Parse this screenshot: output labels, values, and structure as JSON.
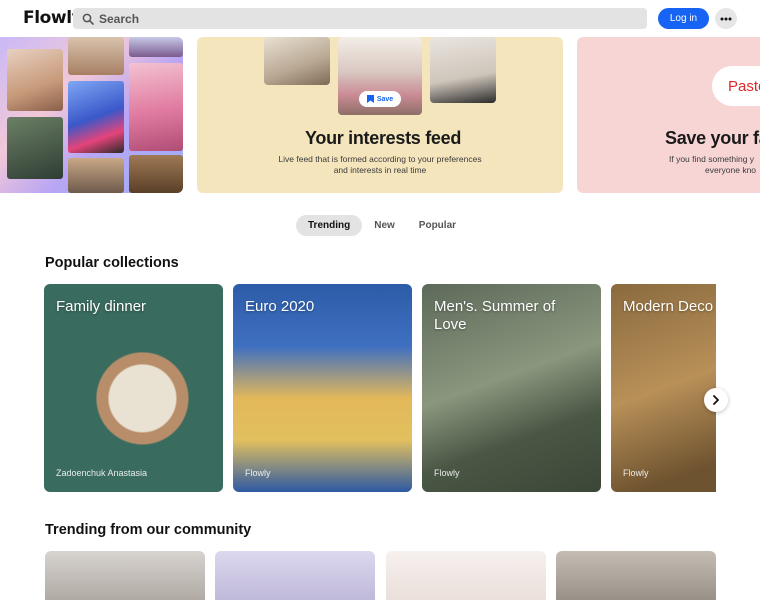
{
  "header": {
    "logo": "Flowly",
    "search_placeholder": "Search",
    "login_label": "Log in",
    "more_icon": "more-dots-icon",
    "accent": "#1763f3"
  },
  "hero": {
    "interests_title": "Your interests feed",
    "interests_subtitle_line1": "Live feed that is formed according to your preferences",
    "interests_subtitle_line2": "and interests in real time",
    "save_pill_label": "Save",
    "save_title": "Save your fa",
    "save_subtitle_line1": "If you find something y",
    "save_subtitle_line2": "everyone kno",
    "paste_label": "Paste"
  },
  "tabs": [
    {
      "label": "Trending",
      "active": true
    },
    {
      "label": "New",
      "active": false
    },
    {
      "label": "Popular",
      "active": false
    }
  ],
  "collections": {
    "title": "Popular collections",
    "items": [
      {
        "title": "Family dinner",
        "author": "Zadoenchuk Anastasia"
      },
      {
        "title": "Euro 2020",
        "author": "Flowly"
      },
      {
        "title": "Men's. Summer of Love",
        "author": "Flowly"
      },
      {
        "title": "Modern Deco More",
        "author": "Flowly"
      }
    ]
  },
  "community": {
    "title": "Trending from our community"
  }
}
